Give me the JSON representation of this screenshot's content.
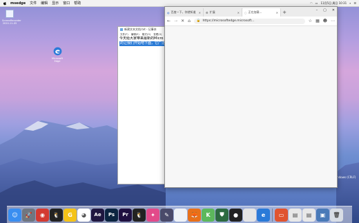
{
  "menubar": {
    "app_name": "msedge",
    "items": [
      "文件",
      "编辑",
      "显示",
      "窗口",
      "帮助"
    ],
    "status": "11月5日 周日 10:31"
  },
  "desktop": {
    "icons": [
      {
        "label": "ScreenRecorder 2020-11-05"
      },
      {
        "label": "Microsoft Edge"
      }
    ],
    "background_label": "indows (CRLF)"
  },
  "notepad": {
    "title": "新建文本文档.txt - 记事本",
    "menu": [
      "文件(F)",
      "编辑(E)",
      "格式(O)",
      "查看(V)"
    ],
    "line1": "今天给大家带来最新的Micro",
    "line2": "的让我们开始吧下面，它广泛"
  },
  "edge": {
    "tabs": [
      {
        "label": "百度一下，你就知道"
      },
      {
        "label": "扩展"
      },
      {
        "label": "正在加载..."
      }
    ],
    "new_tab": "+",
    "address": "https://microsoftedge.microsoft...",
    "window_controls": [
      "–",
      "▢",
      "✕"
    ]
  },
  "dock": {
    "apps": [
      {
        "icon": "finder-icon",
        "color": "#3a8ef0",
        "glyph": "☺"
      },
      {
        "icon": "launchpad-icon",
        "color": "#6f7680",
        "glyph": "🚀"
      },
      {
        "icon": "netease-music-icon",
        "color": "#d33a31",
        "glyph": "◉"
      },
      {
        "icon": "qq-icon",
        "color": "#222222",
        "glyph": "🐧"
      },
      {
        "icon": "gbox-icon",
        "color": "#f4c318",
        "glyph": "G"
      },
      {
        "icon": "chrome-icon",
        "color": "#ffffff",
        "glyph": "◕"
      },
      {
        "icon": "after-effects-icon",
        "color": "#1f1740",
        "glyph": "Ae"
      },
      {
        "icon": "photoshop-icon",
        "color": "#0b2440",
        "glyph": "Ps"
      },
      {
        "icon": "premiere-icon",
        "color": "#1f1040",
        "glyph": "Pr"
      },
      {
        "icon": "qq-icon-2",
        "color": "#222222",
        "glyph": "🐧"
      },
      {
        "icon": "sidefx-icon",
        "color": "#e24a8a",
        "glyph": "✦"
      },
      {
        "icon": "evernote-icon",
        "color": "#4a4a6a",
        "glyph": "✎"
      },
      {
        "icon": "document-icon",
        "color": "#eef2f7",
        "glyph": ""
      },
      {
        "icon": "firefox-icon",
        "color": "#e8701a",
        "glyph": "🦊"
      },
      {
        "icon": "keynote-icon",
        "color": "#5cb85c",
        "glyph": "K"
      },
      {
        "icon": "shield-icon",
        "color": "#2c6a40",
        "glyph": "⛊"
      },
      {
        "icon": "record-icon",
        "color": "#222222",
        "glyph": "●"
      },
      {
        "icon": "filemerge-icon",
        "color": "#e5e5e5",
        "glyph": ""
      },
      {
        "icon": "edge-icon",
        "color": "#2a7ad8",
        "glyph": "e"
      }
    ],
    "right_apps": [
      {
        "icon": "presentation-icon",
        "color": "#e05430",
        "glyph": "▭"
      },
      {
        "icon": "window-icon",
        "color": "#e8e8e8",
        "glyph": "▤"
      },
      {
        "icon": "window-icon-2",
        "color": "#e8e8e8",
        "glyph": "▤"
      },
      {
        "icon": "screenshot-icon",
        "color": "#4a7ab8",
        "glyph": "▣"
      },
      {
        "icon": "trash-icon",
        "color": "#d8dde5",
        "glyph": "🗑"
      }
    ]
  }
}
